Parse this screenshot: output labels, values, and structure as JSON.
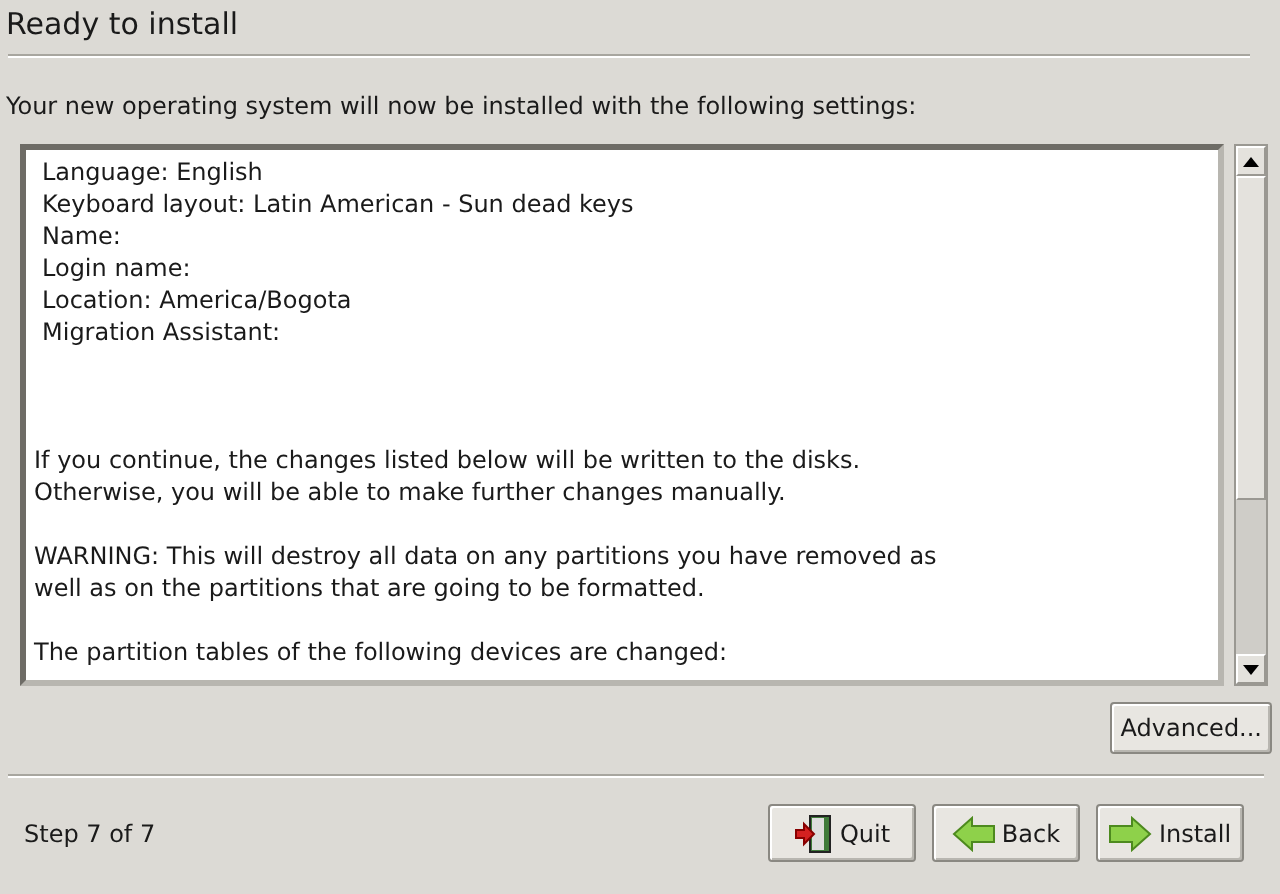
{
  "title": "Ready to install",
  "intro": "Your new operating system will now be installed with the following settings:",
  "summary": {
    "settings": [
      "Language: English",
      "Keyboard layout: Latin American - Sun dead keys",
      "Name:",
      "Login name:",
      "Location: America/Bogota",
      "Migration Assistant:"
    ],
    "paragraphs": [
      [
        "If you continue, the changes listed below will be written to the disks.",
        "Otherwise, you will be able to make further changes manually."
      ],
      [
        "WARNING: This will destroy all data on any partitions you have removed as",
        "well as on the partitions that are going to be formatted."
      ],
      [
        "The partition tables of the following devices are changed:"
      ]
    ]
  },
  "advanced_button": "Advanced...",
  "step": "Step 7 of 7",
  "buttons": [
    {
      "kind": "quit",
      "label": "Quit"
    },
    {
      "kind": "back",
      "label": "Back"
    },
    {
      "kind": "install",
      "label": "Install"
    }
  ]
}
